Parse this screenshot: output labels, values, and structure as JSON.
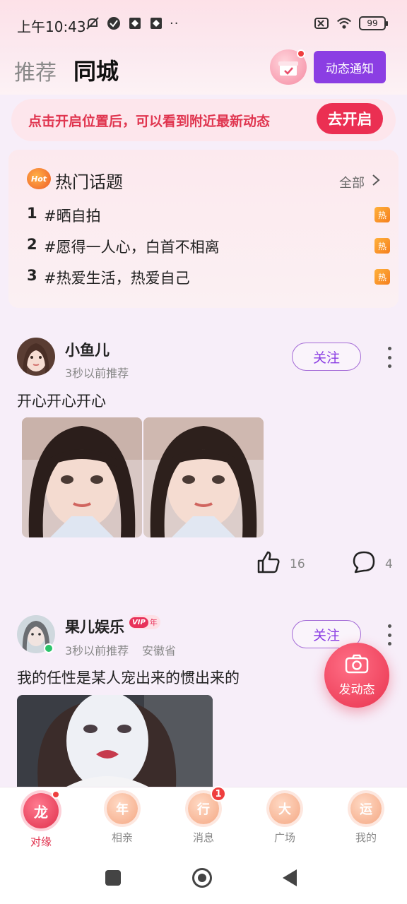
{
  "status_bar": {
    "time": "上午10:43",
    "dots": "··",
    "battery": "99"
  },
  "header": {
    "tab_recommend": "推荐",
    "tab_local": "同城",
    "notify_button": "动态通知"
  },
  "location_banner": {
    "text": "点击开启位置后，可以看到附近最新动态",
    "button": "去开启"
  },
  "hot_topics": {
    "icon_text": "Hot",
    "title": "热门话题",
    "all_label": "全部",
    "tag": "热",
    "items": [
      {
        "rank": "1",
        "text": "#晒自拍"
      },
      {
        "rank": "2",
        "text": "#愿得一人心，白首不相离"
      },
      {
        "rank": "3",
        "text": "#热爱生活，热爱自己"
      }
    ]
  },
  "posts": [
    {
      "username": "小鱼儿",
      "meta": "3秒以前推荐",
      "follow": "关注",
      "text": "开心开心开心",
      "likes": "16",
      "comments": "4"
    },
    {
      "username": "果儿娱乐",
      "vip": "VIP",
      "vip_year": "年",
      "meta": "3秒以前推荐",
      "location": "安徽省",
      "follow": "关注",
      "text": "我的任性是某人宠出来的惯出来的"
    }
  ],
  "fab": {
    "label": "发动态"
  },
  "bottom_nav": {
    "items": [
      {
        "icon": "龙",
        "label": "对缘"
      },
      {
        "icon": "年",
        "label": "相亲"
      },
      {
        "icon": "行",
        "label": "消息",
        "badge": "1"
      },
      {
        "icon": "大",
        "label": "广场"
      },
      {
        "icon": "运",
        "label": "我的"
      }
    ]
  },
  "colors": {
    "accent_purple": "#8b3ee3",
    "accent_red": "#eb2f52",
    "hot_orange": "#f57f1e"
  }
}
